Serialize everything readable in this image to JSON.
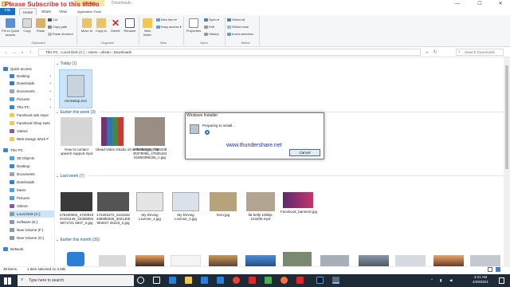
{
  "overlay_caption": "Please Subscribe to this video",
  "window": {
    "title": "Downloads",
    "context_tab": "Manage",
    "context_subtab": "Application Tools",
    "buttons": {
      "minimize": "—",
      "maximize": "☐",
      "close": "✕"
    }
  },
  "ribbon": {
    "tabs": [
      "File",
      "Home",
      "Share",
      "View"
    ],
    "clipboard": {
      "pin_label": "Pin to Quick access",
      "copy_label": "Copy",
      "paste_label": "Paste",
      "cut_label": "Cut",
      "copy_path_label": "Copy path",
      "paste_shortcut_label": "Paste shortcut",
      "group_label": "Clipboard"
    },
    "organize": {
      "move_to": "Move to",
      "copy_to": "Copy to",
      "delete": "Delete",
      "rename": "Rename",
      "group_label": "Organize"
    },
    "new": {
      "new_folder": "New folder",
      "new_item": "New item",
      "easy_access": "Easy access",
      "group_label": "New"
    },
    "open": {
      "properties": "Properties",
      "open": "Open",
      "edit": "Edit",
      "history": "History",
      "group_label": "Open"
    },
    "select": {
      "select_all": "Select all",
      "select_none": "Select none",
      "invert_selection": "Invert selection",
      "group_label": "Select"
    }
  },
  "address": {
    "path": [
      "This PC",
      "Local Disk (C:)",
      "Users",
      "ahsan",
      "Downloads"
    ],
    "separator": "›",
    "search_placeholder": "Search Downloads"
  },
  "nav": {
    "quick_access_label": "Quick access",
    "items": [
      "Desktop",
      "Downloads",
      "Documents",
      "Pictures",
      "This PC",
      "Facebook ads repor",
      "Facebook Shop Sets",
      "Videos",
      "Web Design Work F"
    ],
    "this_pc_label": "This PC",
    "pc_items": [
      "3D Objects",
      "Desktop",
      "Documents",
      "Downloads",
      "Music",
      "Pictures",
      "Videos",
      "Local Disk (C:)",
      "Software (E:)",
      "New Volume (F:)",
      "New Volume (G:)"
    ],
    "network_label": "Network"
  },
  "content": {
    "groups": [
      {
        "head": "Today (1)",
        "files": [
          "ImoSetup.msi"
        ]
      },
      {
        "head": "Earlier this week (3)",
        "files": [
          "How to contact upwork support.mp4",
          "Ulead.Video.Studio.10.serial.keygen.zip",
          "175886723_786043835379095_4750518481850386155_n.jpg"
        ]
      },
      {
        "head": "Last week (7)",
        "files": [
          "176430502_472091034101145_323580946971721 6847_n.jpg",
          "174263272_5111532435986028_3021405963027 26223_n.jpg",
          "My Driving License_1.jpg",
          "My Driving License_2.jpg",
          "hero.jpg",
          "fat belly-1080p-210205.mp4",
          "Facebook_banner2.jpg"
        ]
      },
      {
        "head": "Earlier this month (26)",
        "files": []
      }
    ]
  },
  "dialog": {
    "title": "Windows Installer",
    "message": "Preparing to install...",
    "url": "www.thundershare.net",
    "cancel": "Cancel"
  },
  "status": {
    "items": "39 items",
    "selected": "1 item selected  11.4 MB"
  },
  "taskbar": {
    "search_placeholder": "Type here to search",
    "time": "4:21 AM",
    "date": "4/29/2021"
  },
  "colors": {
    "accent": "#1a6fc7",
    "selection": "#cce4f7",
    "overlay": "#e0282a",
    "link": "#1c2fb0"
  }
}
